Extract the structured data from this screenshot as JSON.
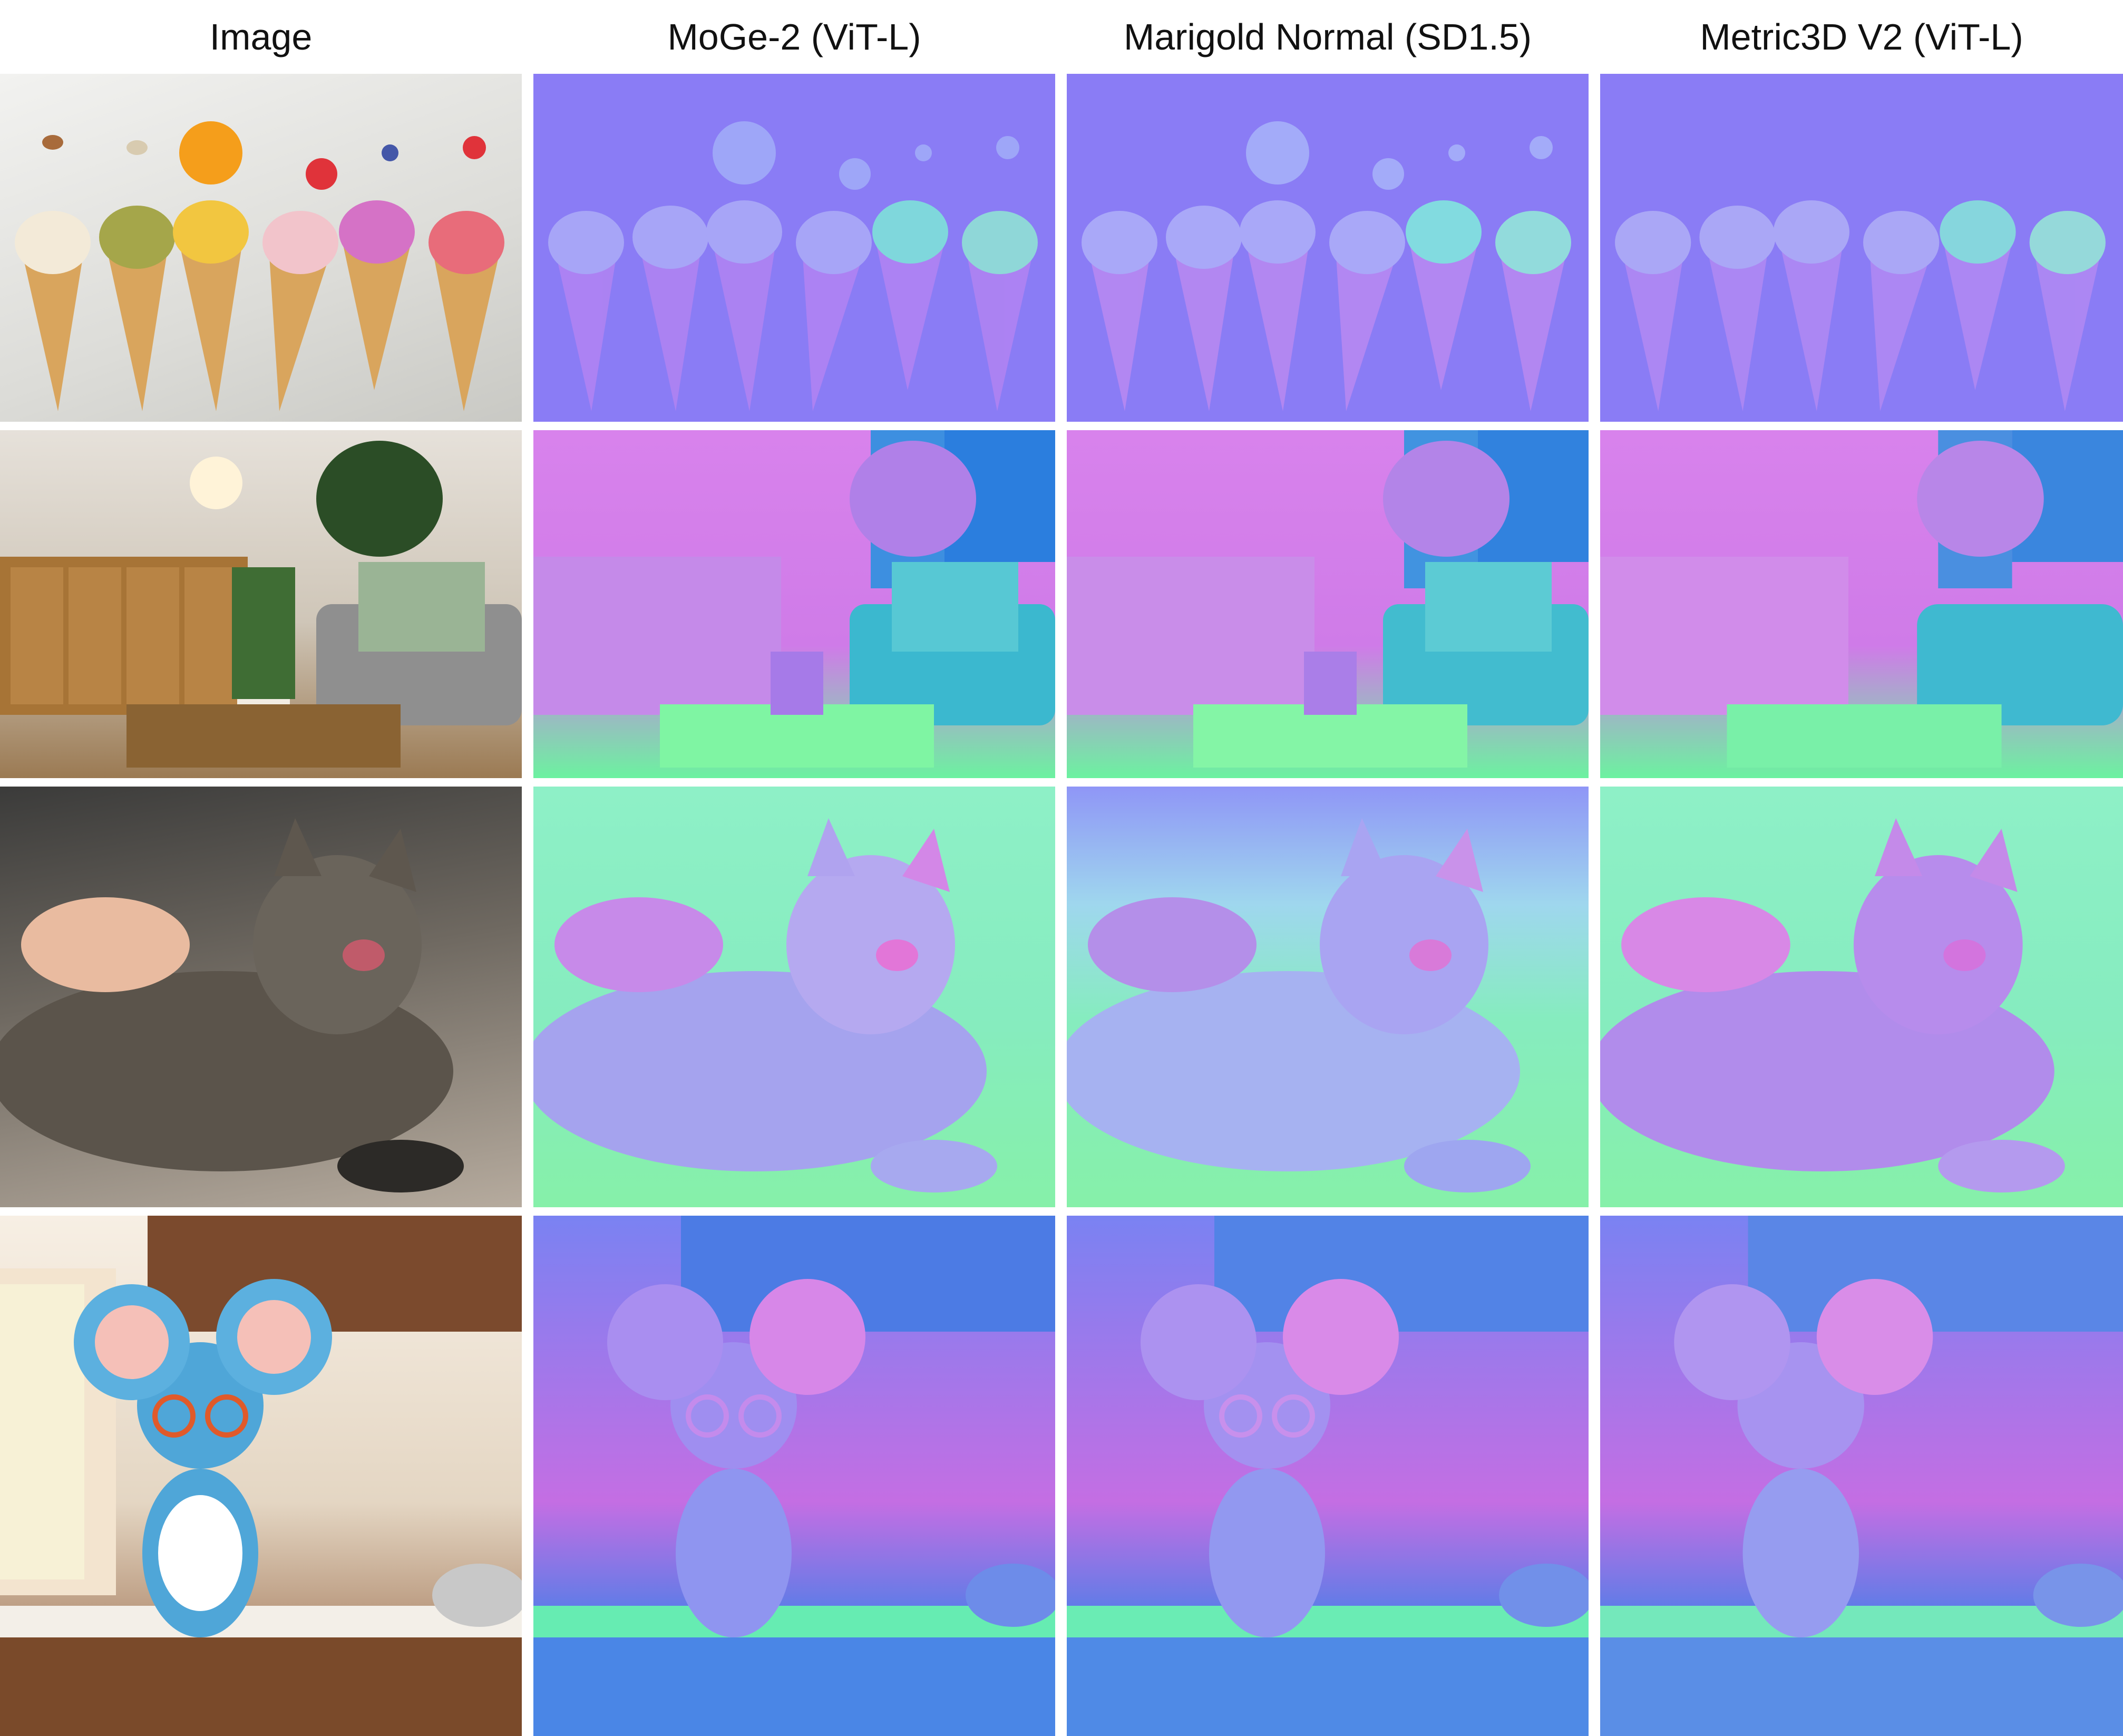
{
  "columns": [
    {
      "header": "Image"
    },
    {
      "header": "MoGe-2 (ViT-L)"
    },
    {
      "header": "Marigold Normal (SD1.5)"
    },
    {
      "header": "Metric3D V2 (ViT-L)"
    }
  ],
  "rows": [
    {
      "scene": "ice-cream-cones"
    },
    {
      "scene": "living-room"
    },
    {
      "scene": "cat"
    },
    {
      "scene": "cartoon-mouse-kitchen"
    }
  ],
  "colors": {
    "normal_blue": "#8a7cf5",
    "normal_pink": "#d882ec",
    "normal_green": "#86f0a9",
    "background": "#ffffff"
  }
}
